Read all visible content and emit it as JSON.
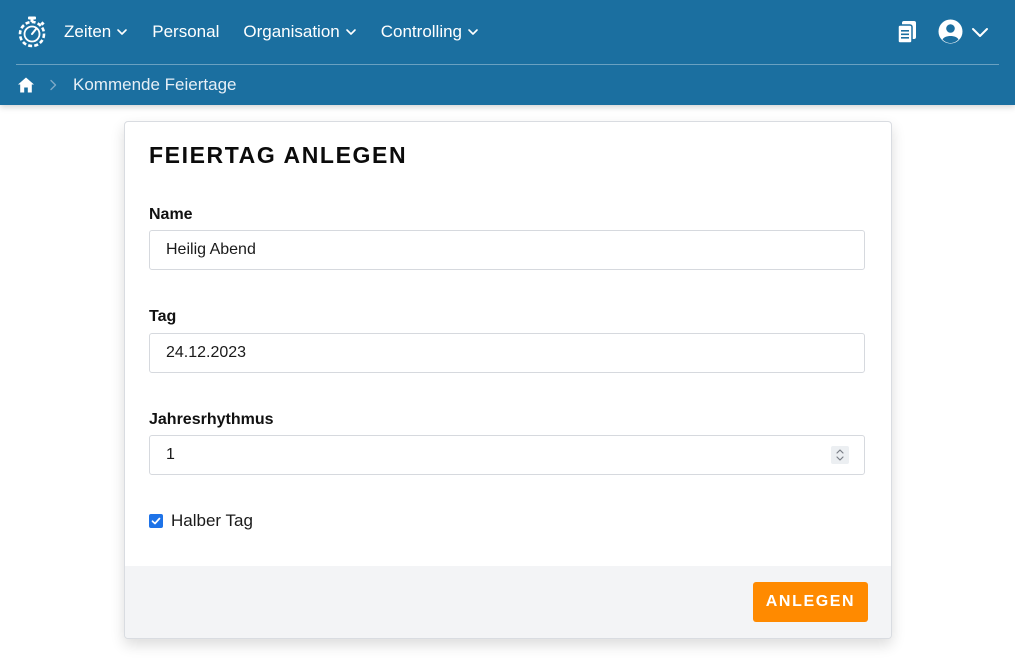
{
  "nav": {
    "items": [
      {
        "label": "Zeiten",
        "has_dropdown": true
      },
      {
        "label": "Personal",
        "has_dropdown": false
      },
      {
        "label": "Organisation",
        "has_dropdown": true
      },
      {
        "label": "Controlling",
        "has_dropdown": true
      }
    ]
  },
  "icons": {
    "logo": "stopwatch-logo-icon",
    "clipboard": "clipboard-list-icon",
    "user": "user-circle-icon",
    "home": "home-icon"
  },
  "breadcrumb": {
    "current": "Kommende Feiertage"
  },
  "form": {
    "title": "FEIERTAG ANLEGEN",
    "name": {
      "label": "Name",
      "value": "Heilig Abend"
    },
    "tag": {
      "label": "Tag",
      "value": "24.12.2023"
    },
    "rhythmus": {
      "label": "Jahresrhythmus",
      "value": "1"
    },
    "halber_tag": {
      "label": "Halber Tag",
      "checked": true
    },
    "submit_label": "ANLEGEN"
  },
  "colors": {
    "header": "#1b6fa0",
    "accent": "#ff8a00",
    "checkbox": "#1e73e8"
  }
}
